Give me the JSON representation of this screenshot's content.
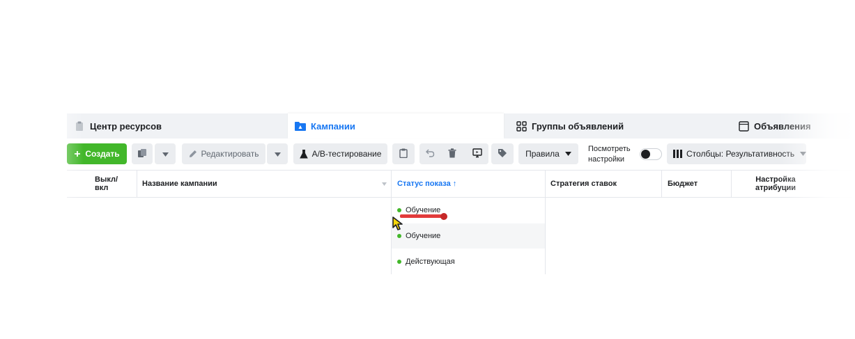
{
  "tabs": [
    {
      "label": "Центр ресурсов",
      "icon": "clipboard-icon",
      "active": false
    },
    {
      "label": "Кампании",
      "icon": "folder-icon",
      "active": true
    },
    {
      "label": "Группы объявлений",
      "icon": "grid-icon",
      "active": false
    },
    {
      "label": "Объявления",
      "icon": "ad-icon",
      "active": false
    }
  ],
  "toolbar": {
    "create_label": "Создать",
    "edit_label": "Редактировать",
    "ab_test_label": "A/B-тестирование",
    "rules_label": "Правила",
    "view_settings_line1": "Посмотреть",
    "view_settings_line2": "настройки",
    "columns_label": "Столбцы: Результативность"
  },
  "table": {
    "headers": {
      "toggle_line1": "Выкл/",
      "toggle_line2": "вкл",
      "campaign_name": "Название кампании",
      "delivery_status": "Статус показа ↑",
      "bid_strategy": "Стратегия ставок",
      "budget": "Бюджет",
      "attribution_line1": "Настройка",
      "attribution_line2": "атрибуции"
    },
    "rows": [
      {
        "status": "Обучение"
      },
      {
        "status": "Обучение"
      },
      {
        "status": "Действующая"
      }
    ]
  },
  "colors": {
    "accent": "#1877f2",
    "create_green": "#42b72a",
    "status_green": "#42b72a",
    "annotation_red": "#e23b3b"
  }
}
